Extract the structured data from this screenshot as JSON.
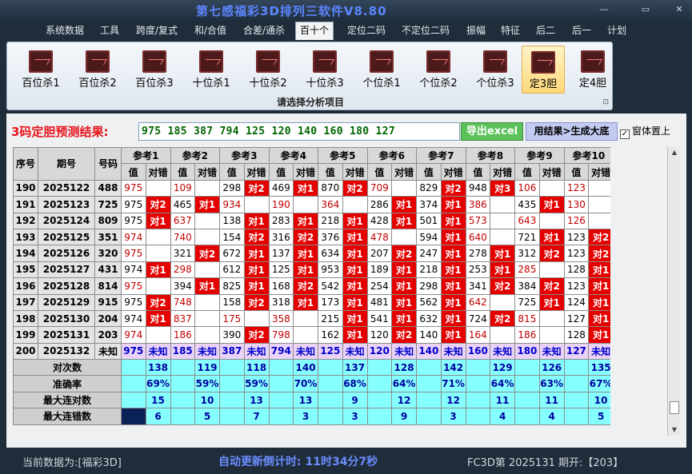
{
  "window": {
    "title": "第七感福彩3D排列三软件V8.80",
    "min_glyph": "—",
    "max_glyph": "▭",
    "close_glyph": "✕"
  },
  "menu": [
    {
      "label": "系统数据"
    },
    {
      "label": "工具"
    },
    {
      "label": "跨度/复式"
    },
    {
      "label": "和/合值"
    },
    {
      "label": "合差/通杀"
    },
    {
      "label": "百十个",
      "active": true
    },
    {
      "label": "定位二码"
    },
    {
      "label": "不定位二码"
    },
    {
      "label": "振幅"
    },
    {
      "label": "特征"
    },
    {
      "label": "后二"
    },
    {
      "label": "后一"
    },
    {
      "label": "计划"
    }
  ],
  "ribbon": {
    "buttons": [
      {
        "label": "百位杀1"
      },
      {
        "label": "百位杀2"
      },
      {
        "label": "百位杀3"
      },
      {
        "label": "十位杀1"
      },
      {
        "label": "十位杀2"
      },
      {
        "label": "十位杀3"
      },
      {
        "label": "个位杀1"
      },
      {
        "label": "个位杀2"
      },
      {
        "label": "个位杀3"
      },
      {
        "label": "定3胆",
        "selected": true
      },
      {
        "label": "定4胆"
      }
    ],
    "caption": "请选择分析项目",
    "corner_glyph": "⊡"
  },
  "prediction": {
    "label": "3码定胆预测结果:",
    "value": "975 185 387 794 125 120 140 160 180 127",
    "excel_button": "导出excel",
    "generate_button": "用结果>生成大底",
    "ontop_label": "窗体置上",
    "ontop_checked": "✓"
  },
  "table": {
    "headers": {
      "seq": "序号",
      "period": "期号",
      "number": "号码",
      "value": "值",
      "hit": "对错"
    },
    "groups": [
      "参考1",
      "参考2",
      "参考3",
      "参考4",
      "参考5",
      "参考6",
      "参考7",
      "参考8",
      "参考9",
      "参考10"
    ],
    "rows": [
      {
        "seq": "190",
        "period": "2025122",
        "num": "488",
        "cells": [
          [
            "975",
            "r",
            ""
          ],
          [
            "109",
            "r",
            ""
          ],
          [
            "298",
            "b",
            "对2"
          ],
          [
            "469",
            "b",
            "对1"
          ],
          [
            "870",
            "b",
            "对2"
          ],
          [
            "709",
            "r",
            ""
          ],
          [
            "829",
            "b",
            "对2"
          ],
          [
            "948",
            "b",
            "对3"
          ],
          [
            "106",
            "r",
            ""
          ],
          [
            "123",
            "r",
            ""
          ]
        ]
      },
      {
        "seq": "191",
        "period": "2025123",
        "num": "725",
        "cells": [
          [
            "975",
            "b",
            "对2"
          ],
          [
            "465",
            "b",
            "对1"
          ],
          [
            "934",
            "r",
            ""
          ],
          [
            "190",
            "r",
            ""
          ],
          [
            "364",
            "r",
            ""
          ],
          [
            "286",
            "b",
            "对1"
          ],
          [
            "374",
            "b",
            "对1"
          ],
          [
            "386",
            "r",
            ""
          ],
          [
            "435",
            "b",
            "对1"
          ],
          [
            "130",
            "r",
            ""
          ]
        ]
      },
      {
        "seq": "192",
        "period": "2025124",
        "num": "809",
        "cells": [
          [
            "975",
            "b",
            "对1"
          ],
          [
            "637",
            "r",
            ""
          ],
          [
            "138",
            "b",
            "对1"
          ],
          [
            "283",
            "b",
            "对1"
          ],
          [
            "218",
            "b",
            "对1"
          ],
          [
            "428",
            "b",
            "对1"
          ],
          [
            "501",
            "b",
            "对1"
          ],
          [
            "573",
            "r",
            ""
          ],
          [
            "643",
            "r",
            ""
          ],
          [
            "126",
            "r",
            ""
          ]
        ]
      },
      {
        "seq": "193",
        "period": "2025125",
        "num": "351",
        "cells": [
          [
            "974",
            "r",
            ""
          ],
          [
            "740",
            "r",
            ""
          ],
          [
            "154",
            "b",
            "对2"
          ],
          [
            "316",
            "b",
            "对2"
          ],
          [
            "376",
            "b",
            "对1"
          ],
          [
            "478",
            "r",
            ""
          ],
          [
            "594",
            "b",
            "对1"
          ],
          [
            "640",
            "r",
            ""
          ],
          [
            "721",
            "b",
            "对1"
          ],
          [
            "123",
            "b",
            "对2"
          ]
        ]
      },
      {
        "seq": "194",
        "period": "2025126",
        "num": "320",
        "cells": [
          [
            "975",
            "r",
            ""
          ],
          [
            "321",
            "b",
            "对2"
          ],
          [
            "672",
            "b",
            "对1"
          ],
          [
            "137",
            "b",
            "对1"
          ],
          [
            "634",
            "b",
            "对1"
          ],
          [
            "207",
            "b",
            "对2"
          ],
          [
            "247",
            "b",
            "对1"
          ],
          [
            "278",
            "b",
            "对1"
          ],
          [
            "312",
            "b",
            "对2"
          ],
          [
            "123",
            "b",
            "对2"
          ]
        ]
      },
      {
        "seq": "195",
        "period": "2025127",
        "num": "431",
        "cells": [
          [
            "974",
            "b",
            "对1"
          ],
          [
            "298",
            "r",
            ""
          ],
          [
            "612",
            "b",
            "对1"
          ],
          [
            "125",
            "b",
            "对1"
          ],
          [
            "953",
            "b",
            "对1"
          ],
          [
            "189",
            "b",
            "对1"
          ],
          [
            "218",
            "b",
            "对1"
          ],
          [
            "253",
            "b",
            "对1"
          ],
          [
            "285",
            "r",
            ""
          ],
          [
            "128",
            "b",
            "对1"
          ]
        ]
      },
      {
        "seq": "196",
        "period": "2025128",
        "num": "814",
        "cells": [
          [
            "975",
            "r",
            ""
          ],
          [
            "394",
            "b",
            "对1"
          ],
          [
            "825",
            "b",
            "对1"
          ],
          [
            "168",
            "b",
            "对2"
          ],
          [
            "542",
            "b",
            "对1"
          ],
          [
            "254",
            "b",
            "对1"
          ],
          [
            "298",
            "b",
            "对1"
          ],
          [
            "341",
            "b",
            "对2"
          ],
          [
            "384",
            "b",
            "对2"
          ],
          [
            "123",
            "b",
            "对1"
          ]
        ]
      },
      {
        "seq": "197",
        "period": "2025129",
        "num": "915",
        "cells": [
          [
            "975",
            "b",
            "对2"
          ],
          [
            "748",
            "r",
            ""
          ],
          [
            "158",
            "b",
            "对2"
          ],
          [
            "318",
            "b",
            "对1"
          ],
          [
            "173",
            "b",
            "对1"
          ],
          [
            "481",
            "b",
            "对1"
          ],
          [
            "562",
            "b",
            "对1"
          ],
          [
            "642",
            "r",
            ""
          ],
          [
            "725",
            "b",
            "对1"
          ],
          [
            "124",
            "b",
            "对1"
          ]
        ]
      },
      {
        "seq": "198",
        "period": "2025130",
        "num": "204",
        "cells": [
          [
            "974",
            "b",
            "对1"
          ],
          [
            "837",
            "r",
            ""
          ],
          [
            "175",
            "r",
            ""
          ],
          [
            "358",
            "r",
            ""
          ],
          [
            "215",
            "b",
            "对1"
          ],
          [
            "541",
            "b",
            "对1"
          ],
          [
            "632",
            "b",
            "对1"
          ],
          [
            "724",
            "b",
            "对2"
          ],
          [
            "815",
            "r",
            ""
          ],
          [
            "127",
            "b",
            "对1"
          ]
        ]
      },
      {
        "seq": "199",
        "period": "2025131",
        "num": "203",
        "cells": [
          [
            "974",
            "r",
            ""
          ],
          [
            "186",
            "r",
            ""
          ],
          [
            "390",
            "b",
            "对2"
          ],
          [
            "798",
            "r",
            ""
          ],
          [
            "162",
            "b",
            "对1"
          ],
          [
            "120",
            "b",
            "对2"
          ],
          [
            "140",
            "b",
            "对1"
          ],
          [
            "164",
            "r",
            ""
          ],
          [
            "186",
            "r",
            ""
          ],
          [
            "128",
            "b",
            "对1"
          ]
        ]
      }
    ],
    "last_row": {
      "seq": "200",
      "period": "2025132",
      "num": "未知",
      "values": [
        "975",
        "185",
        "387",
        "794",
        "125",
        "120",
        "140",
        "160",
        "180",
        "127"
      ],
      "unknown": "未知"
    },
    "stats": [
      {
        "label": "对次数",
        "values": [
          "138",
          "119",
          "118",
          "140",
          "137",
          "128",
          "142",
          "129",
          "126",
          "135"
        ]
      },
      {
        "label": "准确率",
        "values": [
          "69%",
          "59%",
          "59%",
          "70%",
          "68%",
          "64%",
          "71%",
          "64%",
          "63%",
          "67%"
        ]
      },
      {
        "label": "最大连对数",
        "values": [
          "15",
          "10",
          "13",
          "13",
          "9",
          "12",
          "12",
          "11",
          "11",
          "10"
        ]
      },
      {
        "label": "最大连错数",
        "values": [
          "6",
          "5",
          "7",
          "3",
          "3",
          "9",
          "3",
          "4",
          "4",
          "5"
        ]
      }
    ]
  },
  "status": {
    "current_data": "当前数据为:[福彩3D]",
    "countdown": "自动更新倒计时:  11时34分7秒",
    "issue": "FC3D第 2025131 期开:【203】"
  },
  "colors": {
    "hit_bg": "#e50000",
    "stat_bg": "#86ffff",
    "pred_row_bg": "#ead3f7",
    "title": "#5d86ff"
  }
}
